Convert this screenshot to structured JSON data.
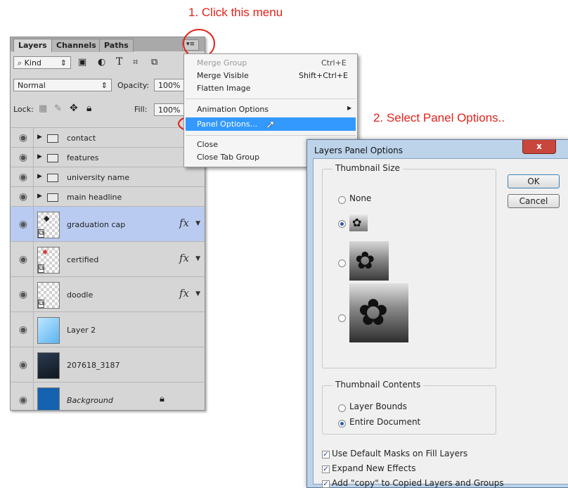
{
  "annotations": {
    "step1": "1. Click this menu",
    "step2": "2. Select Panel Options.."
  },
  "layers_panel": {
    "tabs": [
      "Layers",
      "Channels",
      "Paths"
    ],
    "menu_button": "▾≡",
    "filter": {
      "kind_label": "Kind",
      "icons": [
        "image-filter-icon",
        "adjustment-filter-icon",
        "type-filter-icon",
        "shape-filter-icon",
        "smart-object-filter-icon"
      ]
    },
    "blend_mode": "Normal",
    "opacity_label": "Opacity:",
    "opacity_value": "100%",
    "lock_label": "Lock:",
    "fill_label": "Fill:",
    "fill_value": "100%",
    "layers": [
      {
        "name": "contact",
        "type": "group"
      },
      {
        "name": "features",
        "type": "group"
      },
      {
        "name": "university name",
        "type": "group"
      },
      {
        "name": "main headline",
        "type": "group"
      },
      {
        "name": "graduation cap",
        "type": "smart",
        "fx": "fx",
        "selected": true
      },
      {
        "name": "certified",
        "type": "smart",
        "fx": "fx"
      },
      {
        "name": "doodle",
        "type": "smart",
        "fx": "fx"
      },
      {
        "name": "Layer 2",
        "type": "pixel"
      },
      {
        "name": "207618_3187",
        "type": "image"
      },
      {
        "name": "Background",
        "type": "background",
        "locked": true
      }
    ]
  },
  "panel_menu": {
    "items": [
      {
        "label": "Merge Group",
        "shortcut": "Ctrl+E",
        "disabled": true
      },
      {
        "label": "Merge Visible",
        "shortcut": "Shift+Ctrl+E"
      },
      {
        "label": "Flatten Image",
        "shortcut": ""
      },
      {
        "label": "Animation Options",
        "shortcut": "",
        "submenu": true
      },
      {
        "label": "Panel Options...",
        "shortcut": "",
        "highlighted": true
      },
      {
        "label": "Close",
        "shortcut": ""
      },
      {
        "label": "Close Tab Group",
        "shortcut": ""
      }
    ]
  },
  "dialog": {
    "title": "Layers Panel Options",
    "close_label": "x",
    "thumbnail_size_label": "Thumbnail Size",
    "size_none_label": "None",
    "selected_size": "small",
    "thumbnail_contents_label": "Thumbnail Contents",
    "contents_options": [
      "Layer Bounds",
      "Entire Document"
    ],
    "selected_contents": "Entire Document",
    "checkboxes": [
      {
        "label": "Use Default Masks on Fill Layers",
        "checked": true
      },
      {
        "label": "Expand New Effects",
        "checked": true
      },
      {
        "label": "Add \"copy\" to Copied Layers and Groups",
        "checked": true
      }
    ],
    "ok_label": "OK",
    "cancel_label": "Cancel"
  },
  "colors": {
    "annotation": "#e2231a",
    "selected_layer": "#b9cbf0",
    "menu_highlight": "#3399ff",
    "background_layer": "#1462b0"
  }
}
